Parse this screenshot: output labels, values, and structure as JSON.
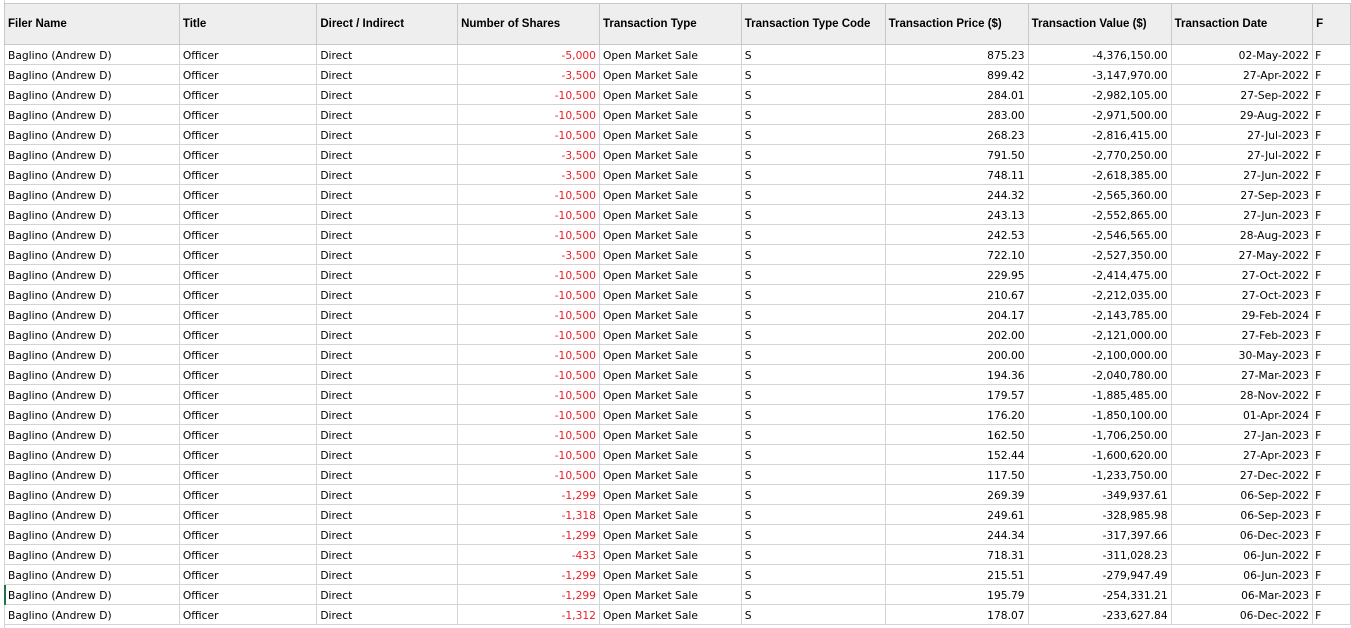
{
  "sheet": {
    "headers": [
      "Filer Name",
      "Title",
      "Direct / Indirect",
      "Number of Shares",
      "Transaction Type",
      "Transaction Type Code",
      "Transaction Price ($)",
      "Transaction Value ($)",
      "Transaction Date",
      "F"
    ],
    "edge_glyph": "F",
    "rows": [
      [
        "Baglino (Andrew D)",
        "Officer",
        "Direct",
        "-5,000",
        "Open Market Sale",
        "S",
        "875.23",
        "-4,376,150.00",
        "02-May-2022"
      ],
      [
        "Baglino (Andrew D)",
        "Officer",
        "Direct",
        "-3,500",
        "Open Market Sale",
        "S",
        "899.42",
        "-3,147,970.00",
        "27-Apr-2022"
      ],
      [
        "Baglino (Andrew D)",
        "Officer",
        "Direct",
        "-10,500",
        "Open Market Sale",
        "S",
        "284.01",
        "-2,982,105.00",
        "27-Sep-2022"
      ],
      [
        "Baglino (Andrew D)",
        "Officer",
        "Direct",
        "-10,500",
        "Open Market Sale",
        "S",
        "283.00",
        "-2,971,500.00",
        "29-Aug-2022"
      ],
      [
        "Baglino (Andrew D)",
        "Officer",
        "Direct",
        "-10,500",
        "Open Market Sale",
        "S",
        "268.23",
        "-2,816,415.00",
        "27-Jul-2023"
      ],
      [
        "Baglino (Andrew D)",
        "Officer",
        "Direct",
        "-3,500",
        "Open Market Sale",
        "S",
        "791.50",
        "-2,770,250.00",
        "27-Jul-2022"
      ],
      [
        "Baglino (Andrew D)",
        "Officer",
        "Direct",
        "-3,500",
        "Open Market Sale",
        "S",
        "748.11",
        "-2,618,385.00",
        "27-Jun-2022"
      ],
      [
        "Baglino (Andrew D)",
        "Officer",
        "Direct",
        "-10,500",
        "Open Market Sale",
        "S",
        "244.32",
        "-2,565,360.00",
        "27-Sep-2023"
      ],
      [
        "Baglino (Andrew D)",
        "Officer",
        "Direct",
        "-10,500",
        "Open Market Sale",
        "S",
        "243.13",
        "-2,552,865.00",
        "27-Jun-2023"
      ],
      [
        "Baglino (Andrew D)",
        "Officer",
        "Direct",
        "-10,500",
        "Open Market Sale",
        "S",
        "242.53",
        "-2,546,565.00",
        "28-Aug-2023"
      ],
      [
        "Baglino (Andrew D)",
        "Officer",
        "Direct",
        "-3,500",
        "Open Market Sale",
        "S",
        "722.10",
        "-2,527,350.00",
        "27-May-2022"
      ],
      [
        "Baglino (Andrew D)",
        "Officer",
        "Direct",
        "-10,500",
        "Open Market Sale",
        "S",
        "229.95",
        "-2,414,475.00",
        "27-Oct-2022"
      ],
      [
        "Baglino (Andrew D)",
        "Officer",
        "Direct",
        "-10,500",
        "Open Market Sale",
        "S",
        "210.67",
        "-2,212,035.00",
        "27-Oct-2023"
      ],
      [
        "Baglino (Andrew D)",
        "Officer",
        "Direct",
        "-10,500",
        "Open Market Sale",
        "S",
        "204.17",
        "-2,143,785.00",
        "29-Feb-2024"
      ],
      [
        "Baglino (Andrew D)",
        "Officer",
        "Direct",
        "-10,500",
        "Open Market Sale",
        "S",
        "202.00",
        "-2,121,000.00",
        "27-Feb-2023"
      ],
      [
        "Baglino (Andrew D)",
        "Officer",
        "Direct",
        "-10,500",
        "Open Market Sale",
        "S",
        "200.00",
        "-2,100,000.00",
        "30-May-2023"
      ],
      [
        "Baglino (Andrew D)",
        "Officer",
        "Direct",
        "-10,500",
        "Open Market Sale",
        "S",
        "194.36",
        "-2,040,780.00",
        "27-Mar-2023"
      ],
      [
        "Baglino (Andrew D)",
        "Officer",
        "Direct",
        "-10,500",
        "Open Market Sale",
        "S",
        "179.57",
        "-1,885,485.00",
        "28-Nov-2022"
      ],
      [
        "Baglino (Andrew D)",
        "Officer",
        "Direct",
        "-10,500",
        "Open Market Sale",
        "S",
        "176.20",
        "-1,850,100.00",
        "01-Apr-2024"
      ],
      [
        "Baglino (Andrew D)",
        "Officer",
        "Direct",
        "-10,500",
        "Open Market Sale",
        "S",
        "162.50",
        "-1,706,250.00",
        "27-Jan-2023"
      ],
      [
        "Baglino (Andrew D)",
        "Officer",
        "Direct",
        "-10,500",
        "Open Market Sale",
        "S",
        "152.44",
        "-1,600,620.00",
        "27-Apr-2023"
      ],
      [
        "Baglino (Andrew D)",
        "Officer",
        "Direct",
        "-10,500",
        "Open Market Sale",
        "S",
        "117.50",
        "-1,233,750.00",
        "27-Dec-2022"
      ],
      [
        "Baglino (Andrew D)",
        "Officer",
        "Direct",
        "-1,299",
        "Open Market Sale",
        "S",
        "269.39",
        "-349,937.61",
        "06-Sep-2022"
      ],
      [
        "Baglino (Andrew D)",
        "Officer",
        "Direct",
        "-1,318",
        "Open Market Sale",
        "S",
        "249.61",
        "-328,985.98",
        "06-Sep-2023"
      ],
      [
        "Baglino (Andrew D)",
        "Officer",
        "Direct",
        "-1,299",
        "Open Market Sale",
        "S",
        "244.34",
        "-317,397.66",
        "06-Dec-2023"
      ],
      [
        "Baglino (Andrew D)",
        "Officer",
        "Direct",
        "-433",
        "Open Market Sale",
        "S",
        "718.31",
        "-311,028.23",
        "06-Jun-2022"
      ],
      [
        "Baglino (Andrew D)",
        "Officer",
        "Direct",
        "-1,299",
        "Open Market Sale",
        "S",
        "215.51",
        "-279,947.49",
        "06-Jun-2023"
      ],
      [
        "Baglino (Andrew D)",
        "Officer",
        "Direct",
        "-1,299",
        "Open Market Sale",
        "S",
        "195.79",
        "-254,331.21",
        "06-Mar-2023"
      ],
      [
        "Baglino (Andrew D)",
        "Officer",
        "Direct",
        "-1,312",
        "Open Market Sale",
        "S",
        "178.07",
        "-233,627.84",
        "06-Dec-2022"
      ]
    ],
    "negative_color": "#e8202a",
    "header_bg": "#eeeeee"
  }
}
